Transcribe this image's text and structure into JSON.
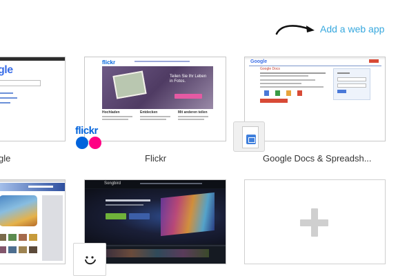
{
  "header": {
    "add_web_app_label": "Add a web app"
  },
  "apps": [
    {
      "id": "google",
      "label": "gle",
      "logo_text": "gle"
    },
    {
      "id": "flickr",
      "label": "Flickr",
      "logo_text": "flickr",
      "headline": "Teilen Sie Ihr Leben in Fotos.",
      "columns": [
        "Hochladen",
        "Entdecken",
        "Mit anderen teilen"
      ]
    },
    {
      "id": "google-docs",
      "label": "Google Docs & Spreadsh...",
      "logo_text": "Google",
      "title": "Google Docs"
    },
    {
      "id": "app4",
      "label": ""
    },
    {
      "id": "songbird",
      "label": "",
      "logo_text": "Songbird"
    },
    {
      "id": "add-app",
      "label": ""
    }
  ],
  "colors": {
    "link": "#37a8de",
    "flickr_blue": "#0063dc",
    "flickr_pink": "#ff0084",
    "tile_border": "#c7c7c7",
    "plus": "#cfcfcf"
  }
}
